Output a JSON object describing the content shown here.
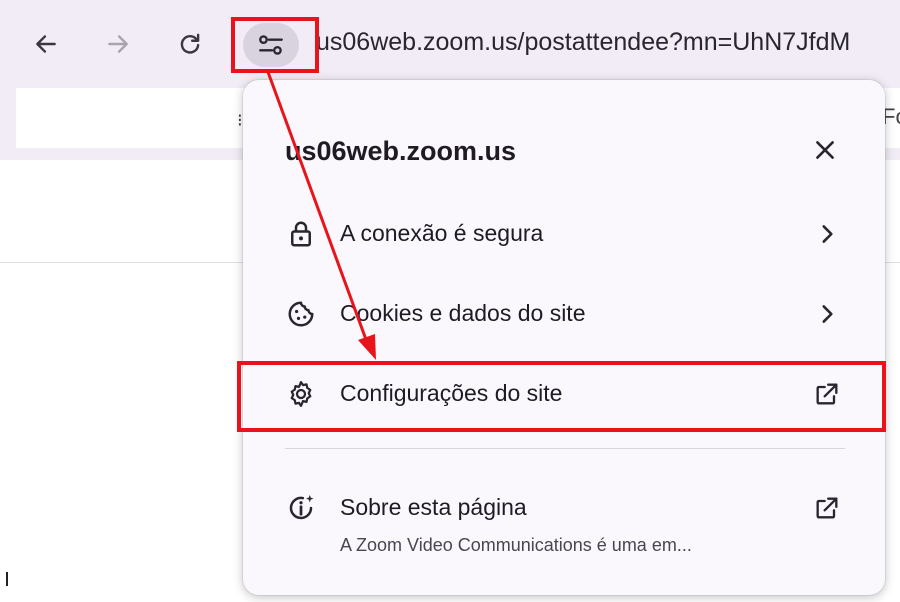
{
  "toolbar": {
    "back_icon": "arrow-left-icon",
    "forward_icon": "arrow-right-icon",
    "reload_icon": "reload-icon",
    "site_info_icon": "tune-icon",
    "url": "us06web.zoom.us/postattendee?mn=UhN7JfdM"
  },
  "bookmarks": {
    "sep": "⁝",
    "fragment": "Fo"
  },
  "popup": {
    "title": "us06web.zoom.us",
    "close_icon": "close-icon",
    "items": [
      {
        "label": "A conexão é segura",
        "icon": "lock-icon",
        "trail_icon": "chevron-right-icon"
      },
      {
        "label": "Cookies e dados do site",
        "icon": "cookie-icon",
        "trail_icon": "chevron-right-icon"
      },
      {
        "label": "Configurações do site",
        "icon": "gear-icon",
        "trail_icon": "open-external-icon"
      },
      {
        "label": "Sobre esta página",
        "sublabel": "A Zoom Video Communications é uma em...",
        "icon": "info-sparkle-icon",
        "trail_icon": "open-external-icon"
      }
    ]
  },
  "annotation": {
    "color": "#e8141b",
    "accent_background": "#f1ecf6"
  }
}
